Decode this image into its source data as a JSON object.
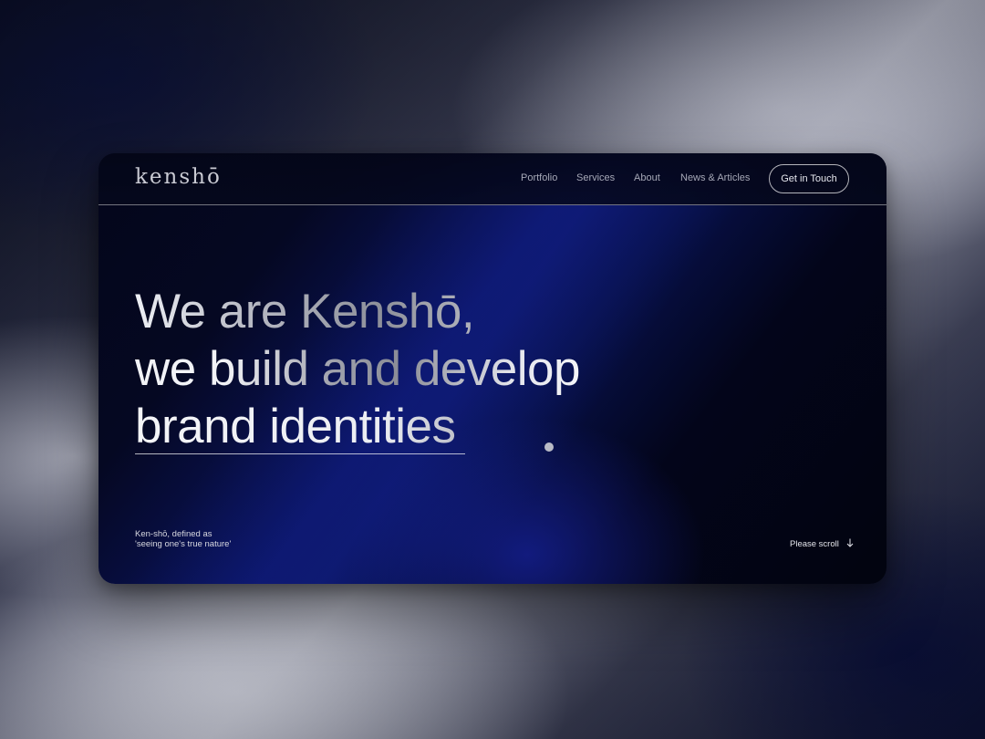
{
  "header": {
    "logo": "kenshō",
    "nav": [
      "Portfolio",
      "Services",
      "About",
      "News & Articles"
    ],
    "cta_label": "Get in Touch"
  },
  "hero": {
    "line1": "We are Kenshō,",
    "line2": "we build and develop",
    "line3": "brand identities"
  },
  "tagline": {
    "line1": "Ken-shō, defined as",
    "line2": "'seeing one's true nature'"
  },
  "scroll": {
    "label": "Please scroll",
    "icon": "arrow-down-icon"
  },
  "colors": {
    "card_bg": "#04061a",
    "accent_blue": "#0a1460",
    "text_light": "#e9eaf0",
    "nav_text": "#a6a8b7"
  }
}
